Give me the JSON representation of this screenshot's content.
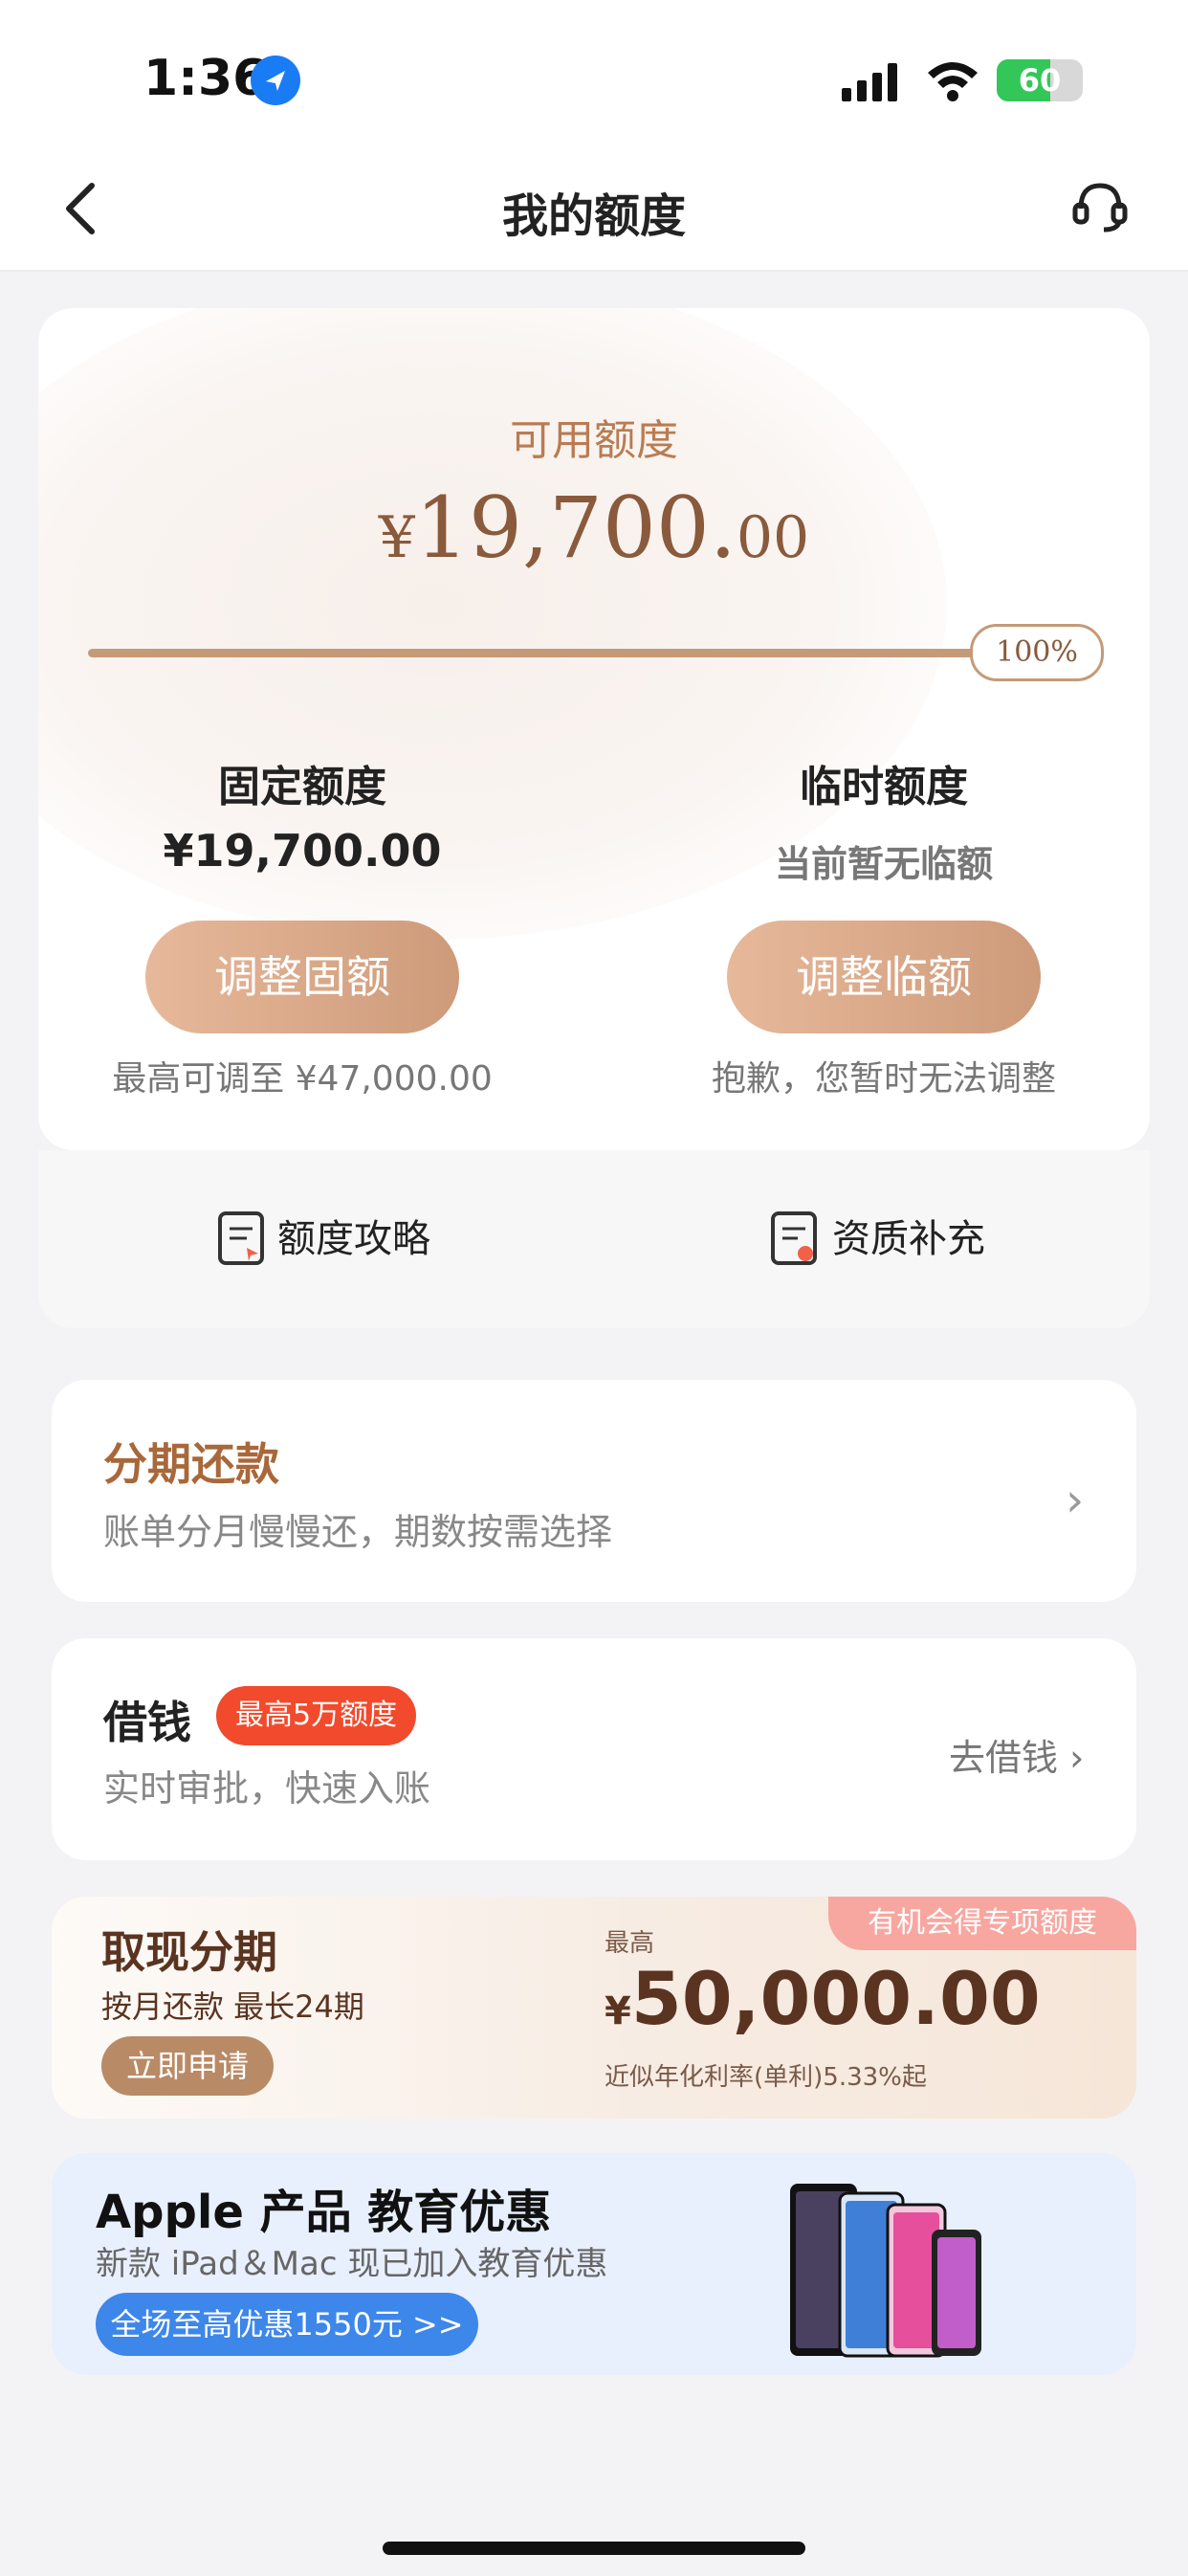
{
  "status_bar": {
    "time": "1:36",
    "battery": "60"
  },
  "header": {
    "title": "我的额度"
  },
  "available": {
    "label": "可用额度",
    "currency": "¥",
    "integer": "19,700.",
    "decimals": "00",
    "progress_percent": 100,
    "progress_label": "100%"
  },
  "fixed": {
    "title": "固定额度",
    "amount": "¥19,700.00",
    "button": "调整固额",
    "note": "最高可调至 ¥47,000.00"
  },
  "temporary": {
    "title": "临时额度",
    "amount": "当前暂无临额",
    "button": "调整临额",
    "note": "抱歉，您暂时无法调整"
  },
  "strip": {
    "left_label": "额度攻略",
    "right_label": "资质补充"
  },
  "installment": {
    "title": "分期还款",
    "subtitle": "账单分月慢慢还，期数按需选择",
    "chevron": "›"
  },
  "borrow": {
    "title": "借钱",
    "badge": "最高5万额度",
    "subtitle": "实时审批，快速入账",
    "action": "去借钱 ›"
  },
  "cash": {
    "title": "取现分期",
    "subtitle": "按月还款 最长24期",
    "button": "立即申请",
    "ribbon": "有机会得专项额度",
    "top_label": "最高",
    "currency": "¥",
    "amount": "50,000.00",
    "rate": "近似年化利率(单利)5.33%起"
  },
  "apple": {
    "title": "Apple 产品 教育优惠",
    "subtitle": "新款 iPad＆Mac 现已加入教育优惠",
    "button": "全场至高优惠1550元 >>"
  },
  "colors": {
    "accent": "#c59a78",
    "brand_text": "#8a5a3c",
    "badge_red": "#f24a2c",
    "apple_blue": "#3d86ea"
  }
}
